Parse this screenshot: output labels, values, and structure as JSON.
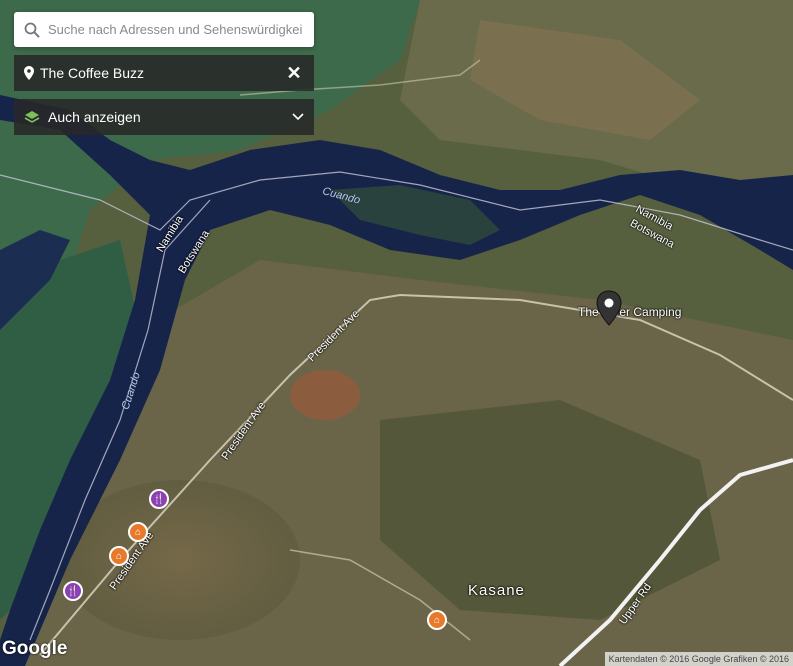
{
  "search": {
    "placeholder": "Suche nach Adressen und Sehenswürdigkeiten",
    "icon": "search-icon"
  },
  "place": {
    "name": "The Coffee Buzz",
    "icon": "map-marker-icon",
    "close_label": "✕"
  },
  "layers": {
    "label": "Auch anzeigen",
    "icon": "layers-icon",
    "chevron": "chevron-down-icon"
  },
  "map": {
    "labels": {
      "river_top": "Cuando",
      "river_left": "Cuando",
      "border_left_namibia": "Namibia",
      "border_left_botswana": "Botswana",
      "border_right_namibia": "Namibia",
      "border_right_botswana": "Botswana",
      "camping": "The River Camping",
      "road_president_1": "President Ave",
      "road_president_2": "President Ave",
      "road_president_3": "President Ave",
      "road_upper": "Upper Rd",
      "town": "Kasane"
    }
  },
  "branding": {
    "logo": "Google"
  },
  "attribution": "Kartendaten © 2016 Google Grafiken © 2016"
}
